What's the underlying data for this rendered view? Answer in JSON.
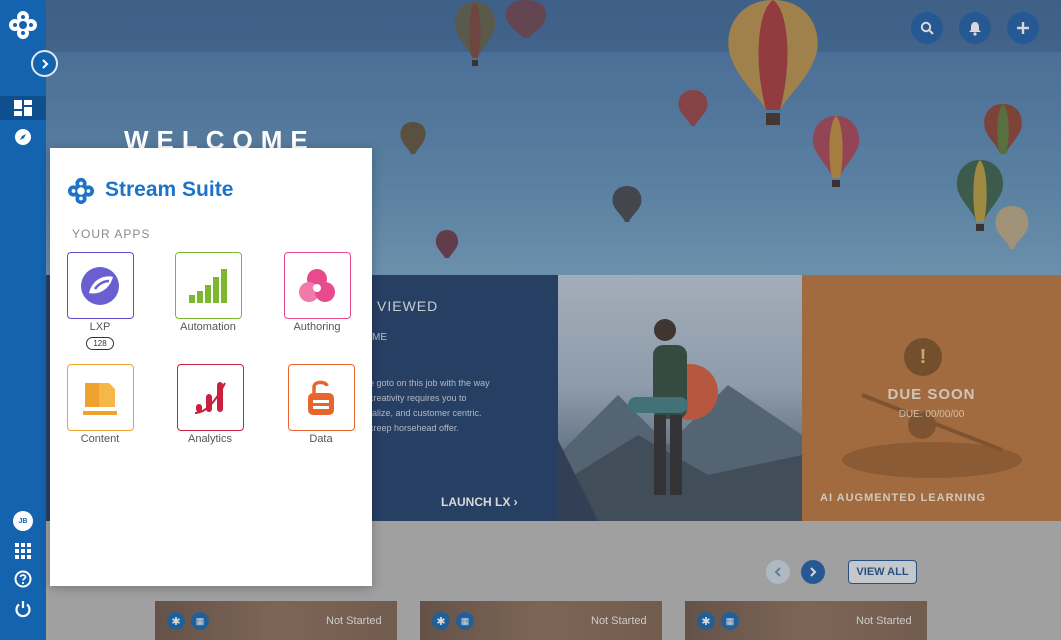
{
  "hero": {
    "welcome": "WELCOME"
  },
  "header_icons": [
    "search-icon",
    "bell-icon",
    "plus-icon"
  ],
  "recently_viewed": {
    "heading": "VIEWED",
    "subheading": "ME",
    "description": [
      "e goto on this job with the way",
      "creativity requires you to",
      "ralize, and customer centric.",
      "creep horsehead offer."
    ],
    "launch_label": "LAUNCH LX ›"
  },
  "due_soon": {
    "title": "DUE SOON",
    "date": "DUE: 00/00/00",
    "footer": "AI AUGMENTED LEARNING"
  },
  "carousel": {
    "view_all_label": "VIEW ALL",
    "cards": [
      {
        "status": "Not Started"
      },
      {
        "status": "Not Started"
      },
      {
        "status": "Not Started"
      }
    ]
  },
  "user": {
    "initials": "JB"
  },
  "panel": {
    "title": "Stream Suite",
    "section_label": "YOUR APPS",
    "apps": [
      {
        "label": "LXP",
        "badge": "128",
        "color": "#5a4fc8"
      },
      {
        "label": "Automation",
        "color": "#7cb82f"
      },
      {
        "label": "Authoring",
        "color": "#e84a8e"
      },
      {
        "label": "Content",
        "color": "#f0a22e"
      },
      {
        "label": "Analytics",
        "color": "#c8203d"
      },
      {
        "label": "Data",
        "color": "#e8662e"
      }
    ]
  },
  "colors": {
    "brand_blue": "#1463ae",
    "title_blue": "#1c74c9",
    "navy_panel": "#1d3a69",
    "orange_panel": "#b8733a"
  }
}
